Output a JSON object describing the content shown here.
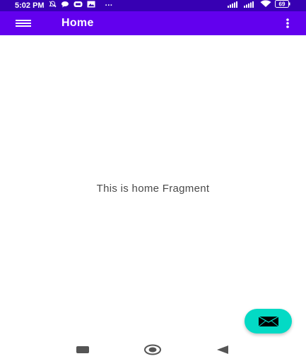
{
  "status_bar": {
    "time": "5:02 PM",
    "dots": "···",
    "battery_level": "69",
    "icons": [
      "mute-icon",
      "chat-icon",
      "mail-icon",
      "image-icon",
      "signal-icon",
      "signal-icon",
      "wifi-icon",
      "battery-icon"
    ]
  },
  "app_bar": {
    "title": "Home",
    "menu_icon": "menu-icon",
    "overflow_icon": "more-vert-icon"
  },
  "content": {
    "message": "This is home Fragment"
  },
  "fab": {
    "icon": "mail-icon"
  },
  "nav_bar": {
    "icons": [
      "recents-icon",
      "home-icon",
      "back-icon"
    ]
  },
  "colors": {
    "status_bar": "#3700b3",
    "app_bar": "#6200ee",
    "fab": "#03dac5"
  }
}
